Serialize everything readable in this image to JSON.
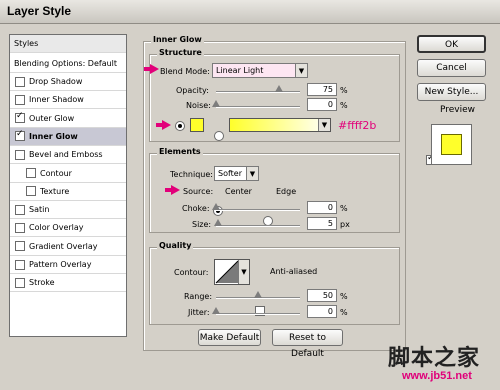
{
  "window": {
    "title": "Layer Style"
  },
  "styles_list": {
    "header": "Styles",
    "blending": "Blending Options: Default",
    "items": [
      {
        "label": "Drop Shadow",
        "checked": false,
        "indent": false
      },
      {
        "label": "Inner Shadow",
        "checked": false,
        "indent": false
      },
      {
        "label": "Outer Glow",
        "checked": true,
        "indent": false
      },
      {
        "label": "Inner Glow",
        "checked": true,
        "indent": false,
        "selected": true
      },
      {
        "label": "Bevel and Emboss",
        "checked": false,
        "indent": false
      },
      {
        "label": "Contour",
        "checked": false,
        "indent": true
      },
      {
        "label": "Texture",
        "checked": false,
        "indent": true
      },
      {
        "label": "Satin",
        "checked": false,
        "indent": false
      },
      {
        "label": "Color Overlay",
        "checked": false,
        "indent": false
      },
      {
        "label": "Gradient Overlay",
        "checked": false,
        "indent": false
      },
      {
        "label": "Pattern Overlay",
        "checked": false,
        "indent": false
      },
      {
        "label": "Stroke",
        "checked": false,
        "indent": false
      }
    ]
  },
  "inner_glow": {
    "title": "Inner Glow",
    "structure": {
      "title": "Structure",
      "blend_mode_label": "Blend Mode:",
      "blend_mode_value": "Linear Light",
      "opacity_label": "Opacity:",
      "opacity_value": "75",
      "opacity_unit": "%",
      "noise_label": "Noise:",
      "noise_value": "0",
      "noise_unit": "%",
      "color_hex": "#ffff2b",
      "color_annotation": "#ffff2b"
    },
    "elements": {
      "title": "Elements",
      "technique_label": "Technique:",
      "technique_value": "Softer",
      "source_label": "Source:",
      "source_center": "Center",
      "source_edge": "Edge",
      "choke_label": "Choke:",
      "choke_value": "0",
      "choke_unit": "%",
      "size_label": "Size:",
      "size_value": "5",
      "size_unit": "px"
    },
    "quality": {
      "title": "Quality",
      "contour_label": "Contour:",
      "anti_aliased_label": "Anti-aliased",
      "range_label": "Range:",
      "range_value": "50",
      "range_unit": "%",
      "jitter_label": "Jitter:",
      "jitter_value": "0",
      "jitter_unit": "%"
    },
    "make_default": "Make Default",
    "reset_default": "Reset to Default"
  },
  "buttons": {
    "ok": "OK",
    "cancel": "Cancel",
    "new_style": "New Style...",
    "preview": "Preview"
  },
  "watermark": {
    "main": "脚本之家",
    "url": "www.jb51.net"
  },
  "colors": {
    "glow_yellow": "#ffff2b",
    "annotation_magenta": "#e2007a"
  }
}
